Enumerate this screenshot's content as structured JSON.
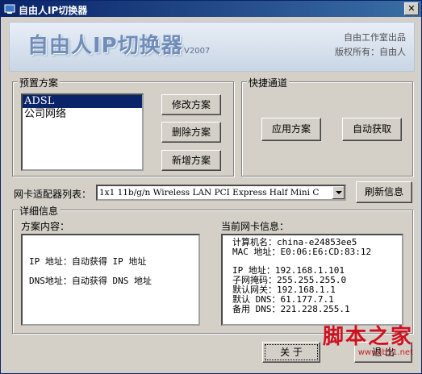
{
  "window": {
    "title": "自由人IP切换器",
    "close_label": "✕"
  },
  "banner": {
    "logo": "自由人IP切换器",
    "version": "V2007",
    "credit1": "自由工作室出品",
    "credit2": "版权所有：自由人"
  },
  "presets": {
    "group_label": "预置方案",
    "items": [
      "ADSL",
      "公司网络"
    ],
    "selected_index": 0,
    "modify_label": "修改方案",
    "delete_label": "删除方案",
    "add_label": "新增方案"
  },
  "quick": {
    "group_label": "快捷通道",
    "apply_label": "应用方案",
    "auto_label": "自动获取"
  },
  "adapter": {
    "label": "网卡适配器列表：",
    "selected": "1x1 11b/g/n Wireless LAN PCI Express Half Mini C",
    "refresh_label": "刷新信息"
  },
  "details": {
    "group_label": "详细信息",
    "plan_label": "方案内容：",
    "plan_lines": [
      "IP 地址：自动获得 IP 地址",
      "DNS地址：自动获得 DNS 地址"
    ],
    "current_label": "当前网卡信息：",
    "current_lines": [
      "计算机名：china-e24853ee5",
      "MAC 地址：E0:06:E6:CD:83:12",
      "",
      "IP  地址：192.168.1.101",
      "子网掩码：255.255.255.0",
      "默认网关：192.168.1.1",
      "默认 DNS：61.177.7.1",
      "备用 DNS：221.228.255.1"
    ]
  },
  "footer": {
    "about_label": "关 于",
    "exit_label": "退 出"
  },
  "watermark": {
    "title": "脚本之家",
    "url": "www.jb51.net"
  }
}
